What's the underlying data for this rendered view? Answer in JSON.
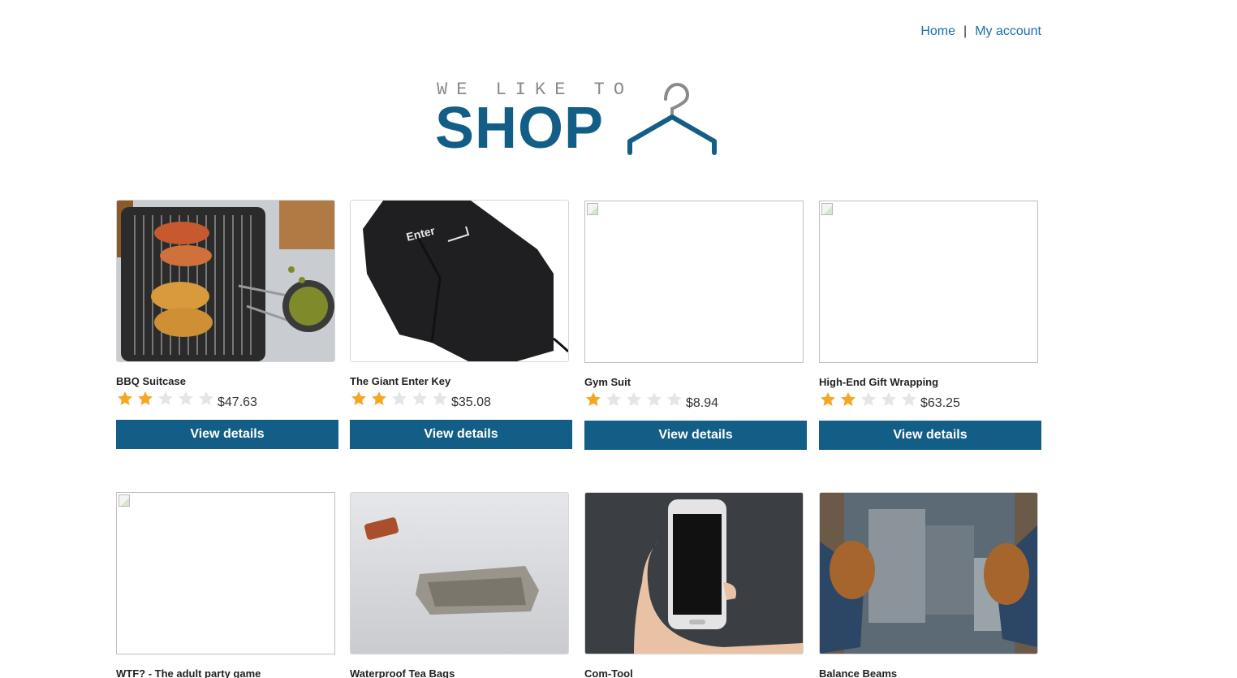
{
  "nav": {
    "home": "Home",
    "separator": "|",
    "account": "My account"
  },
  "logo": {
    "tagline": "WE LIKE TO",
    "word": "SHOP",
    "icon": "hanger-icon"
  },
  "colors": {
    "brand": "#135e87",
    "link": "#1a6fa8",
    "star_filled": "#f5a623",
    "star_empty": "#e3e6e9"
  },
  "products": [
    {
      "name": "BBQ Suitcase",
      "rating": 2,
      "price": "$47.63",
      "button": "View details",
      "image": "bbq"
    },
    {
      "name": "The Giant Enter Key",
      "rating": 2,
      "price": "$35.08",
      "button": "View details",
      "image": "enterkey"
    },
    {
      "name": "Gym Suit",
      "rating": 1,
      "price": "$8.94",
      "button": "View details",
      "image": "broken"
    },
    {
      "name": "High-End Gift Wrapping",
      "rating": 2,
      "price": "$63.25",
      "button": "View details",
      "image": "broken"
    },
    {
      "name": "WTF? - The adult party game",
      "rating": 0,
      "price": "",
      "button": "",
      "image": "broken"
    },
    {
      "name": "Waterproof Tea Bags",
      "rating": 0,
      "price": "",
      "button": "",
      "image": "teabag"
    },
    {
      "name": "Com-Tool",
      "rating": 0,
      "price": "",
      "button": "",
      "image": "phone"
    },
    {
      "name": "Balance Beams",
      "rating": 0,
      "price": "",
      "button": "",
      "image": "beams"
    }
  ]
}
